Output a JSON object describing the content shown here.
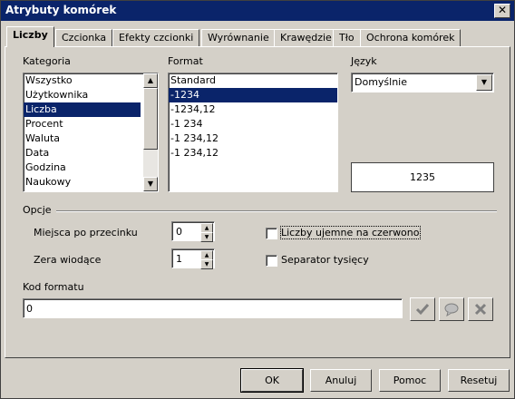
{
  "window": {
    "title": "Atrybuty komórek",
    "close_glyph": "✕"
  },
  "tabs": [
    {
      "label": "Liczby"
    },
    {
      "label": "Czcionka"
    },
    {
      "label": "Efekty czcionki"
    },
    {
      "label": "Wyrównanie"
    },
    {
      "label": "Krawędzie"
    },
    {
      "label": "Tło"
    },
    {
      "label": "Ochrona komórek"
    }
  ],
  "category": {
    "label": "Kategoria",
    "items": [
      "Wszystko",
      "Użytkownika",
      "Liczba",
      "Procent",
      "Waluta",
      "Data",
      "Godzina",
      "Naukowy"
    ],
    "selected": "Liczba"
  },
  "format": {
    "label": "Format",
    "items": [
      "Standard",
      "-1234",
      "-1234,12",
      "-1 234",
      "-1 234,12",
      "-1 234,12"
    ],
    "selected": "-1234"
  },
  "language": {
    "label": "Język",
    "value": "Domyślnie"
  },
  "preview": {
    "value": "1235"
  },
  "options": {
    "label": "Opcje",
    "decimal_places_label": "Miejsca po przecinku",
    "decimal_places_value": "0",
    "leading_zeros_label": "Zera wiodące",
    "leading_zeros_value": "1",
    "negative_red_label": "Liczby ujemne na czerwono",
    "negative_red_checked": false,
    "thousands_sep_label": "Separator tysięcy",
    "thousands_sep_checked": false
  },
  "format_code": {
    "label": "Kod formatu",
    "value": "0"
  },
  "buttons": {
    "ok": "OK",
    "cancel": "Anuluj",
    "help": "Pomoc",
    "reset": "Resetuj"
  },
  "icons": {
    "accept": "checkmark-icon",
    "comment": "comment-icon",
    "delete": "delete-x-icon"
  }
}
